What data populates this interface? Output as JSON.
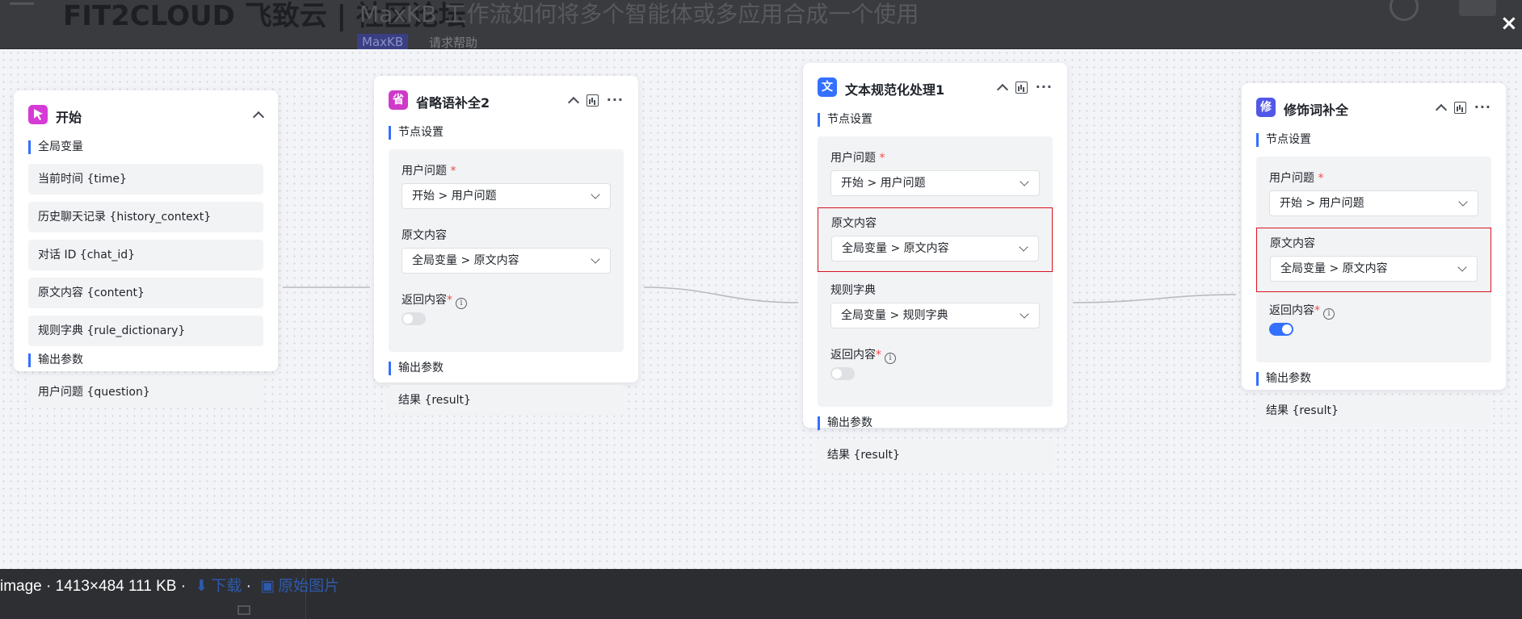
{
  "background": {
    "title": "FIT2CLOUD 飞致云 | 社区论坛",
    "post_title": "MaxKB 工作流如何将多个智能体或多应用合成一个使用",
    "tag": "MaxKB",
    "help_link": "请求帮助"
  },
  "viewer": {
    "close_label": "×",
    "caption": "image · 1413×484 111 KB · ",
    "download_label": "下载",
    "separator": " · ",
    "original_label": "原始图片"
  },
  "colors": {
    "accent": "#3370ff",
    "highlight": "#d9121f",
    "start_icon": "#d63bd6",
    "node2_icon": "#cf39c9",
    "node3_icon": "#3370ff",
    "node4_icon": "#5157e6"
  },
  "nodes": {
    "start": {
      "icon": "cursor-icon",
      "title": "开始",
      "global_vars_title": "全局变量",
      "global_vars": [
        "当前时间 {time}",
        "历史聊天记录 {history_context}",
        "对话 ID {chat_id}",
        "原文内容 {content}",
        "规则字典 {rule_dictionary}"
      ],
      "output_title": "输出参数",
      "outputs": [
        "用户问题 {question}"
      ]
    },
    "abbr": {
      "icon_char": "省",
      "title": "省略语补全2",
      "settings_title": "节点设置",
      "question_label": "用户问题",
      "question_value": "开始 > 用户问题",
      "content_label": "原文内容",
      "content_value": "全局变量 > 原文内容",
      "return_label": "返回内容",
      "return_on": false,
      "output_title": "输出参数",
      "output_value": "结果 {result}"
    },
    "normalize": {
      "icon_char": "文",
      "title": "文本规范化处理1",
      "settings_title": "节点设置",
      "question_label": "用户问题",
      "question_value": "开始 > 用户问题",
      "content_label": "原文内容",
      "content_value": "全局变量 > 原文内容",
      "rules_label": "规则字典",
      "rules_value": "全局变量 > 规则字典",
      "return_label": "返回内容",
      "return_on": false,
      "output_title": "输出参数",
      "output_value": "结果 {result}"
    },
    "modifier": {
      "icon_char": "修",
      "title": "修饰词补全",
      "settings_title": "节点设置",
      "question_label": "用户问题",
      "question_value": "开始 > 用户问题",
      "content_label": "原文内容",
      "content_value": "全局变量 > 原文内容",
      "return_label": "返回内容",
      "return_on": true,
      "output_title": "输出参数",
      "output_value": "结果 {result}"
    }
  }
}
